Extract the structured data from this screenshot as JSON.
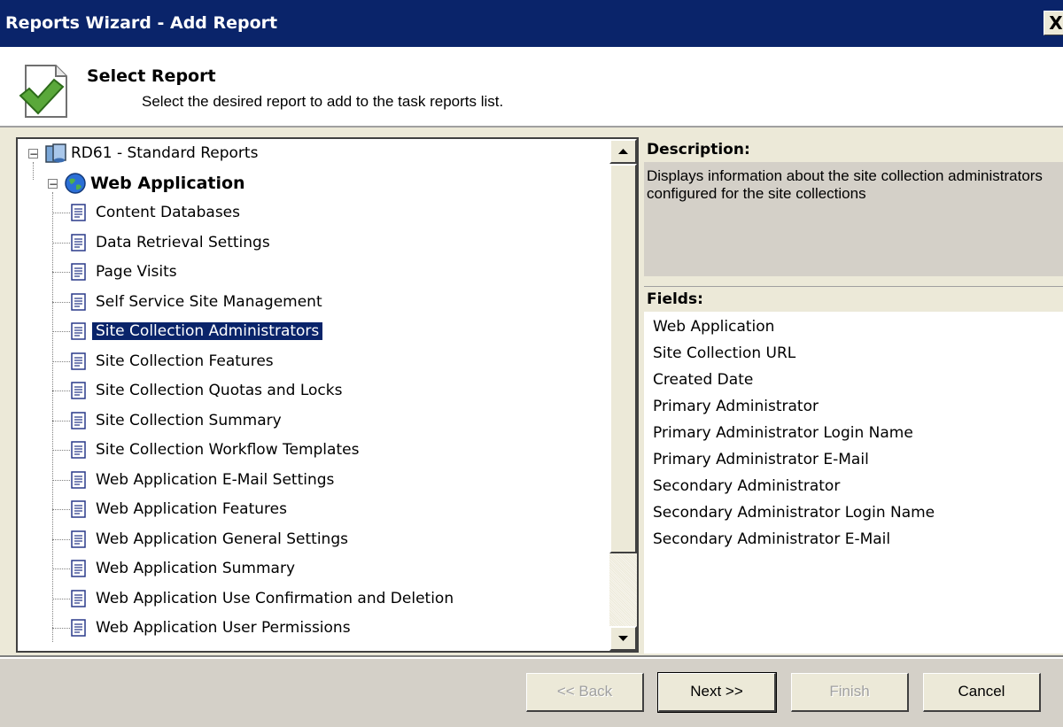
{
  "window": {
    "title": "Reports Wizard - Add Report",
    "close_label": "X"
  },
  "header": {
    "title": "Select Report",
    "subtitle": "Select the desired report to add to the task reports list."
  },
  "tree": {
    "root": {
      "label": "RD61 - Standard Reports",
      "icon": "server-icon"
    },
    "group": {
      "label": "Web Application",
      "icon": "globe-icon"
    },
    "items": [
      "Content Databases",
      "Data Retrieval Settings",
      "Page Visits",
      "Self Service Site Management",
      "Site Collection Administrators",
      "Site Collection Features",
      "Site Collection Quotas and Locks",
      "Site Collection Summary",
      "Site Collection Workflow Templates",
      "Web Application E-Mail Settings",
      "Web Application Features",
      "Web Application General Settings",
      "Web Application Summary",
      "Web Application Use Confirmation and Deletion",
      "Web Application User Permissions"
    ],
    "selected_index": 4
  },
  "description": {
    "heading": "Description:",
    "text": "Displays information about the site collection administrators configured for the site collections"
  },
  "fields": {
    "heading": "Fields:",
    "items": [
      "Web Application",
      "Site Collection URL",
      "Created Date",
      "Primary Administrator",
      "Primary Administrator Login Name",
      "Primary Administrator E-Mail",
      "Secondary Administrator",
      "Secondary Administrator Login Name",
      "Secondary Administrator E-Mail"
    ]
  },
  "buttons": {
    "back": "<< Back",
    "next": "Next >>",
    "finish": "Finish",
    "cancel": "Cancel"
  }
}
